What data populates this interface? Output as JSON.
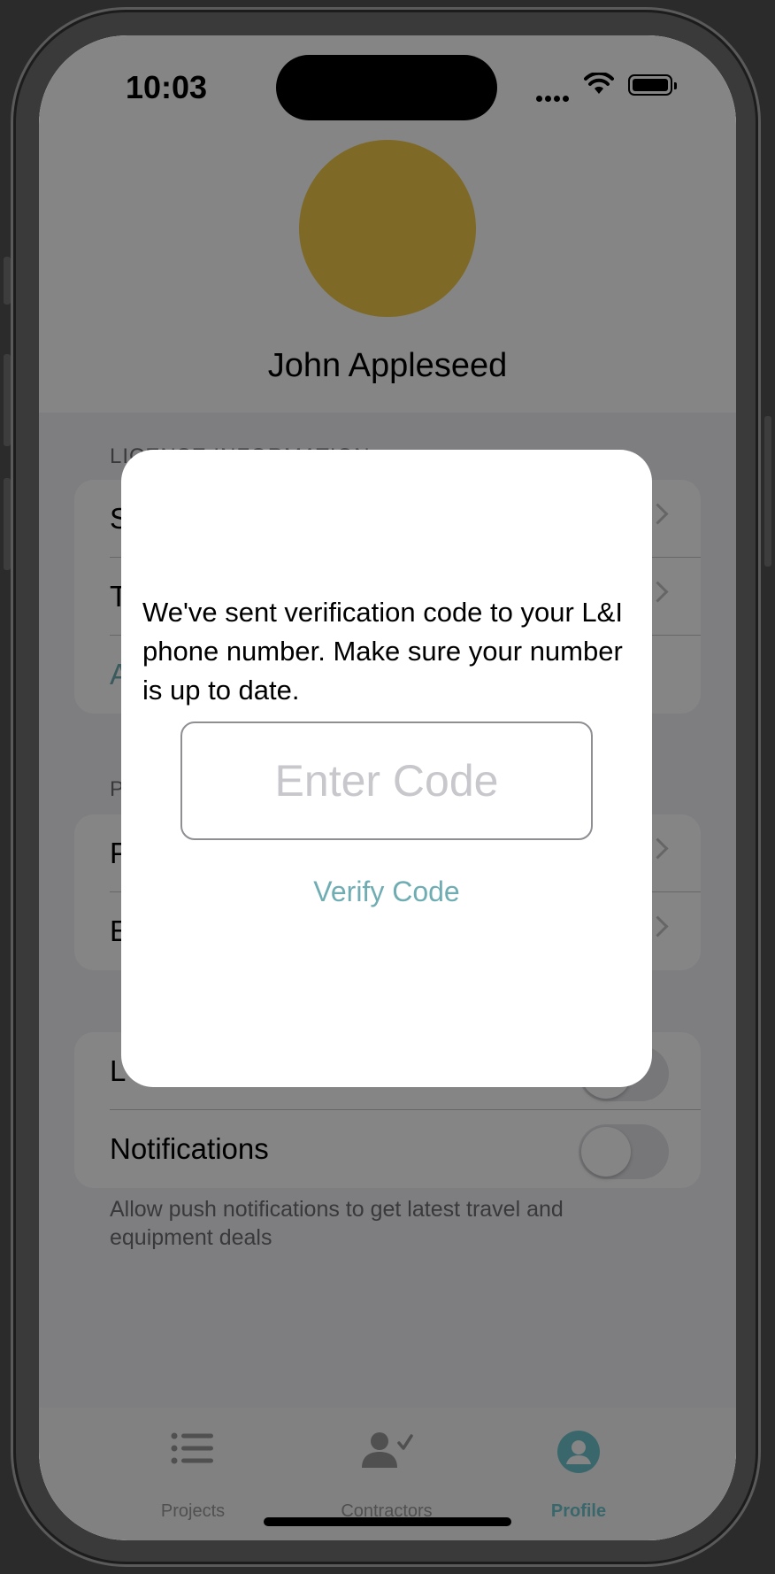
{
  "status_bar": {
    "time": "10:03"
  },
  "profile": {
    "name": "John Appleseed",
    "avatar_color": "#f2c94c"
  },
  "sections": {
    "license": {
      "header": "LICENSE INFORMATION",
      "rows": [
        "S",
        "T",
        "A"
      ]
    },
    "personal": {
      "header": "P",
      "rows": [
        "P",
        "E"
      ]
    },
    "settings": {
      "rows": [
        {
          "label": "L",
          "toggle": false
        },
        {
          "label": "Notifications",
          "toggle": false
        }
      ],
      "footer": "Allow push notifications to get latest travel and equipment deals"
    }
  },
  "tabs": [
    {
      "label": "Projects",
      "icon": "list-icon",
      "active": false
    },
    {
      "label": "Contractors",
      "icon": "person-check-icon",
      "active": false
    },
    {
      "label": "Profile",
      "icon": "profile-icon",
      "active": true
    }
  ],
  "modal": {
    "message": "We've sent verification code to your L&I phone number. Make sure your number is up to date.",
    "code_placeholder": "Enter Code",
    "code_value": "",
    "verify_label": "Verify Code"
  },
  "colors": {
    "accent": "#6fadb3",
    "tab_active": "#6fc6cf",
    "tab_inactive": "#9a9a9a",
    "overlay": "rgba(0,0,0,0.48)"
  }
}
